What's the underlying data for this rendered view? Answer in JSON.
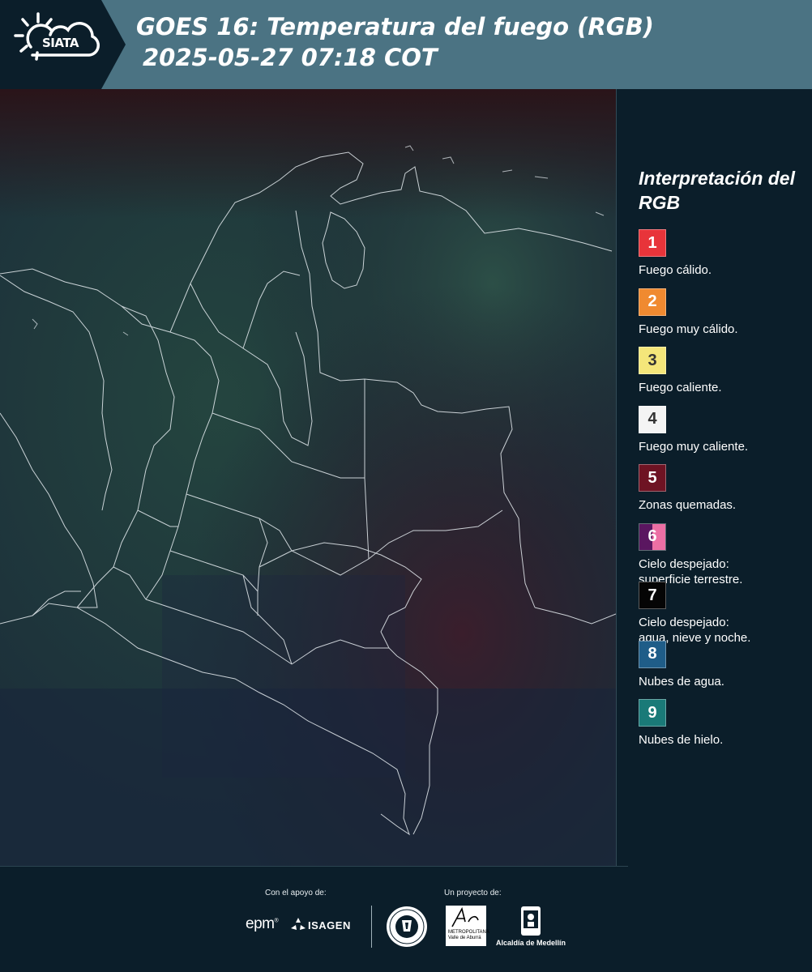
{
  "header": {
    "logo_text": "SIATA",
    "title": "GOES 16: Temperatura del fuego (RGB)",
    "subtitle": "2025-05-27 07:18 COT"
  },
  "map": {
    "icon": "satellite-map-image"
  },
  "legend": {
    "title": "Interpretación del RGB",
    "items": [
      {
        "num": "1",
        "label": "Fuego cálido.",
        "color": "#e8343a"
      },
      {
        "num": "2",
        "label": "Fuego muy cálido.",
        "color": "#f08a30"
      },
      {
        "num": "3",
        "label": "Fuego caliente.",
        "color": "#f4e67a"
      },
      {
        "num": "4",
        "label": "Fuego muy caliente.",
        "color": "#f4f4f4"
      },
      {
        "num": "5",
        "label": "Zonas quemadas.",
        "color": "#6e1323"
      },
      {
        "num": "6",
        "label": "Cielo despejado:\nsuperficie terrestre.",
        "color": "#5a1660",
        "color2": "#ec6fa4"
      },
      {
        "num": "7",
        "label": "Cielo despejado:\nagua, nieve y noche.",
        "color": "#050505"
      },
      {
        "num": "8",
        "label": "Nubes de agua.",
        "color": "#1f5d88"
      },
      {
        "num": "9",
        "label": "Nubes de hielo.",
        "color": "#1a7a78"
      }
    ]
  },
  "footer": {
    "support_label": "Con el apoyo de:",
    "project_label": "Un proyecto de:",
    "epm": "epm",
    "isagen": "ISAGEN",
    "area_text": "METROPOLITANA\nValle de Aburrá",
    "alcaldia": "Alcaldía de Medellín"
  }
}
